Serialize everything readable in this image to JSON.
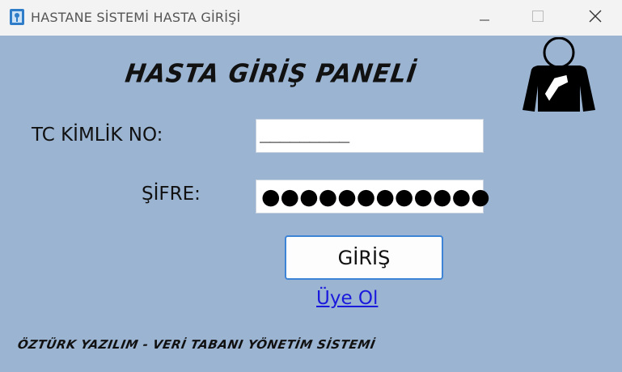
{
  "window": {
    "title": "HASTANE SİSTEMİ HASTA GİRİŞİ",
    "icon": "hospital-app-icon"
  },
  "controls": {
    "minimize_icon": "minimize-icon",
    "maximize_icon": "maximize-icon",
    "close_icon": "close-icon"
  },
  "panel": {
    "title": "HASTA GİRİŞ PANELİ",
    "patient_icon": "patient-icon"
  },
  "form": {
    "tc_label": "TC KİMLİK NO:",
    "tc_value": "_________",
    "password_label": "ŞİFRE:",
    "password_value": "●●●●●●●●●●●●",
    "login_label": "GİRİŞ",
    "register_link": "Üye Ol"
  },
  "footer": {
    "text": "ÖZTÜRK YAZILIM - VERİ TABANI YÖNETİM SİSTEMİ"
  },
  "colors": {
    "client_background": "#9bb4d2",
    "titlebar_background": "#f3f3f3",
    "button_border": "#3d84d6",
    "link": "#1a1adc"
  }
}
